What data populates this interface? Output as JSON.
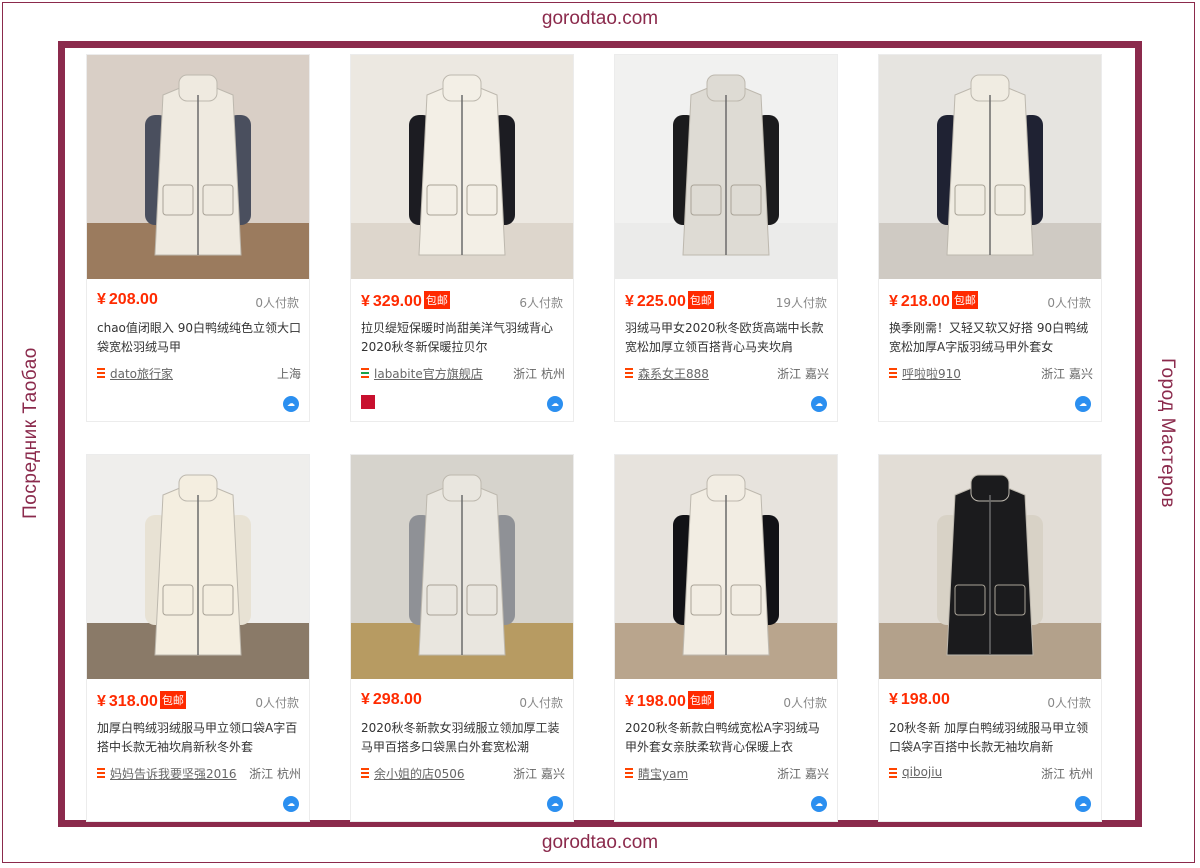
{
  "site": {
    "top_text": "gorodtao.com",
    "bottom_text": "gorodtao.com",
    "left_text": "Посредник  Таобао",
    "right_text": "Город Мастеров",
    "frame_color": "#8b2a4c"
  },
  "currency_symbol": "¥",
  "free_shipping_label": "包邮",
  "colors": {
    "price": "#ff2a00",
    "badge": "#ff2a00",
    "chat": "#2b8ff0"
  },
  "products": [
    {
      "price": "208.00",
      "free_shipping": false,
      "sales": "0人付款",
      "title": "chao值闭眼入 90白鸭绒纯色立领大口袋宽松羽绒马甲",
      "shop": "dato旅行家",
      "location": "上海",
      "icon": "chat-icon"
    },
    {
      "price": "329.00",
      "free_shipping": true,
      "sales": "6人付款",
      "title": "拉贝缇短保暖时尚甜美洋气羽绒背心2020秋冬新保暖拉贝尔",
      "shop": "lababite官方旗舰店",
      "location": "浙江 杭州",
      "icon": "chat-icon"
    },
    {
      "price": "225.00",
      "free_shipping": true,
      "sales": "19人付款",
      "title": "羽绒马甲女2020秋冬欧货高端中长款宽松加厚立领百搭背心马夹坎肩",
      "shop": "森系女王888",
      "location": "浙江 嘉兴",
      "icon": "chat-icon"
    },
    {
      "price": "218.00",
      "free_shipping": true,
      "sales": "0人付款",
      "title": "换季刚需！又轻又软又好搭 90白鸭绒宽松加厚A字版羽绒马甲外套女",
      "shop": "呼啦啦910",
      "location": "浙江 嘉兴",
      "icon": "chat-icon"
    },
    {
      "price": "318.00",
      "free_shipping": true,
      "sales": "0人付款",
      "title": "加厚白鸭绒羽绒服马甲立领口袋A字百搭中长款无袖坎肩新秋冬外套",
      "shop": "妈妈告诉我要坚强2016",
      "location": "浙江 杭州",
      "icon": "chat-icon"
    },
    {
      "price": "298.00",
      "free_shipping": false,
      "sales": "0人付款",
      "title": "2020秋冬新款女羽绒服立领加厚工装马甲百搭多口袋黑白外套宽松潮",
      "shop": "余小姐的店0506",
      "location": "浙江 嘉兴",
      "icon": "chat-icon"
    },
    {
      "price": "198.00",
      "free_shipping": true,
      "sales": "0人付款",
      "title": "2020秋冬新款白鸭绒宽松A字羽绒马甲外套女亲肤柔软背心保暖上衣",
      "shop": "睛宝yam",
      "location": "浙江 嘉兴",
      "icon": "chat-icon"
    },
    {
      "price": "198.00",
      "free_shipping": false,
      "sales": "0人付款",
      "title": "20秋冬新 加厚白鸭绒羽绒服马甲立领口袋A字百搭中长款无袖坎肩新",
      "shop": "qibojiu",
      "location": "浙江 杭州",
      "icon": "chat-icon"
    }
  ]
}
